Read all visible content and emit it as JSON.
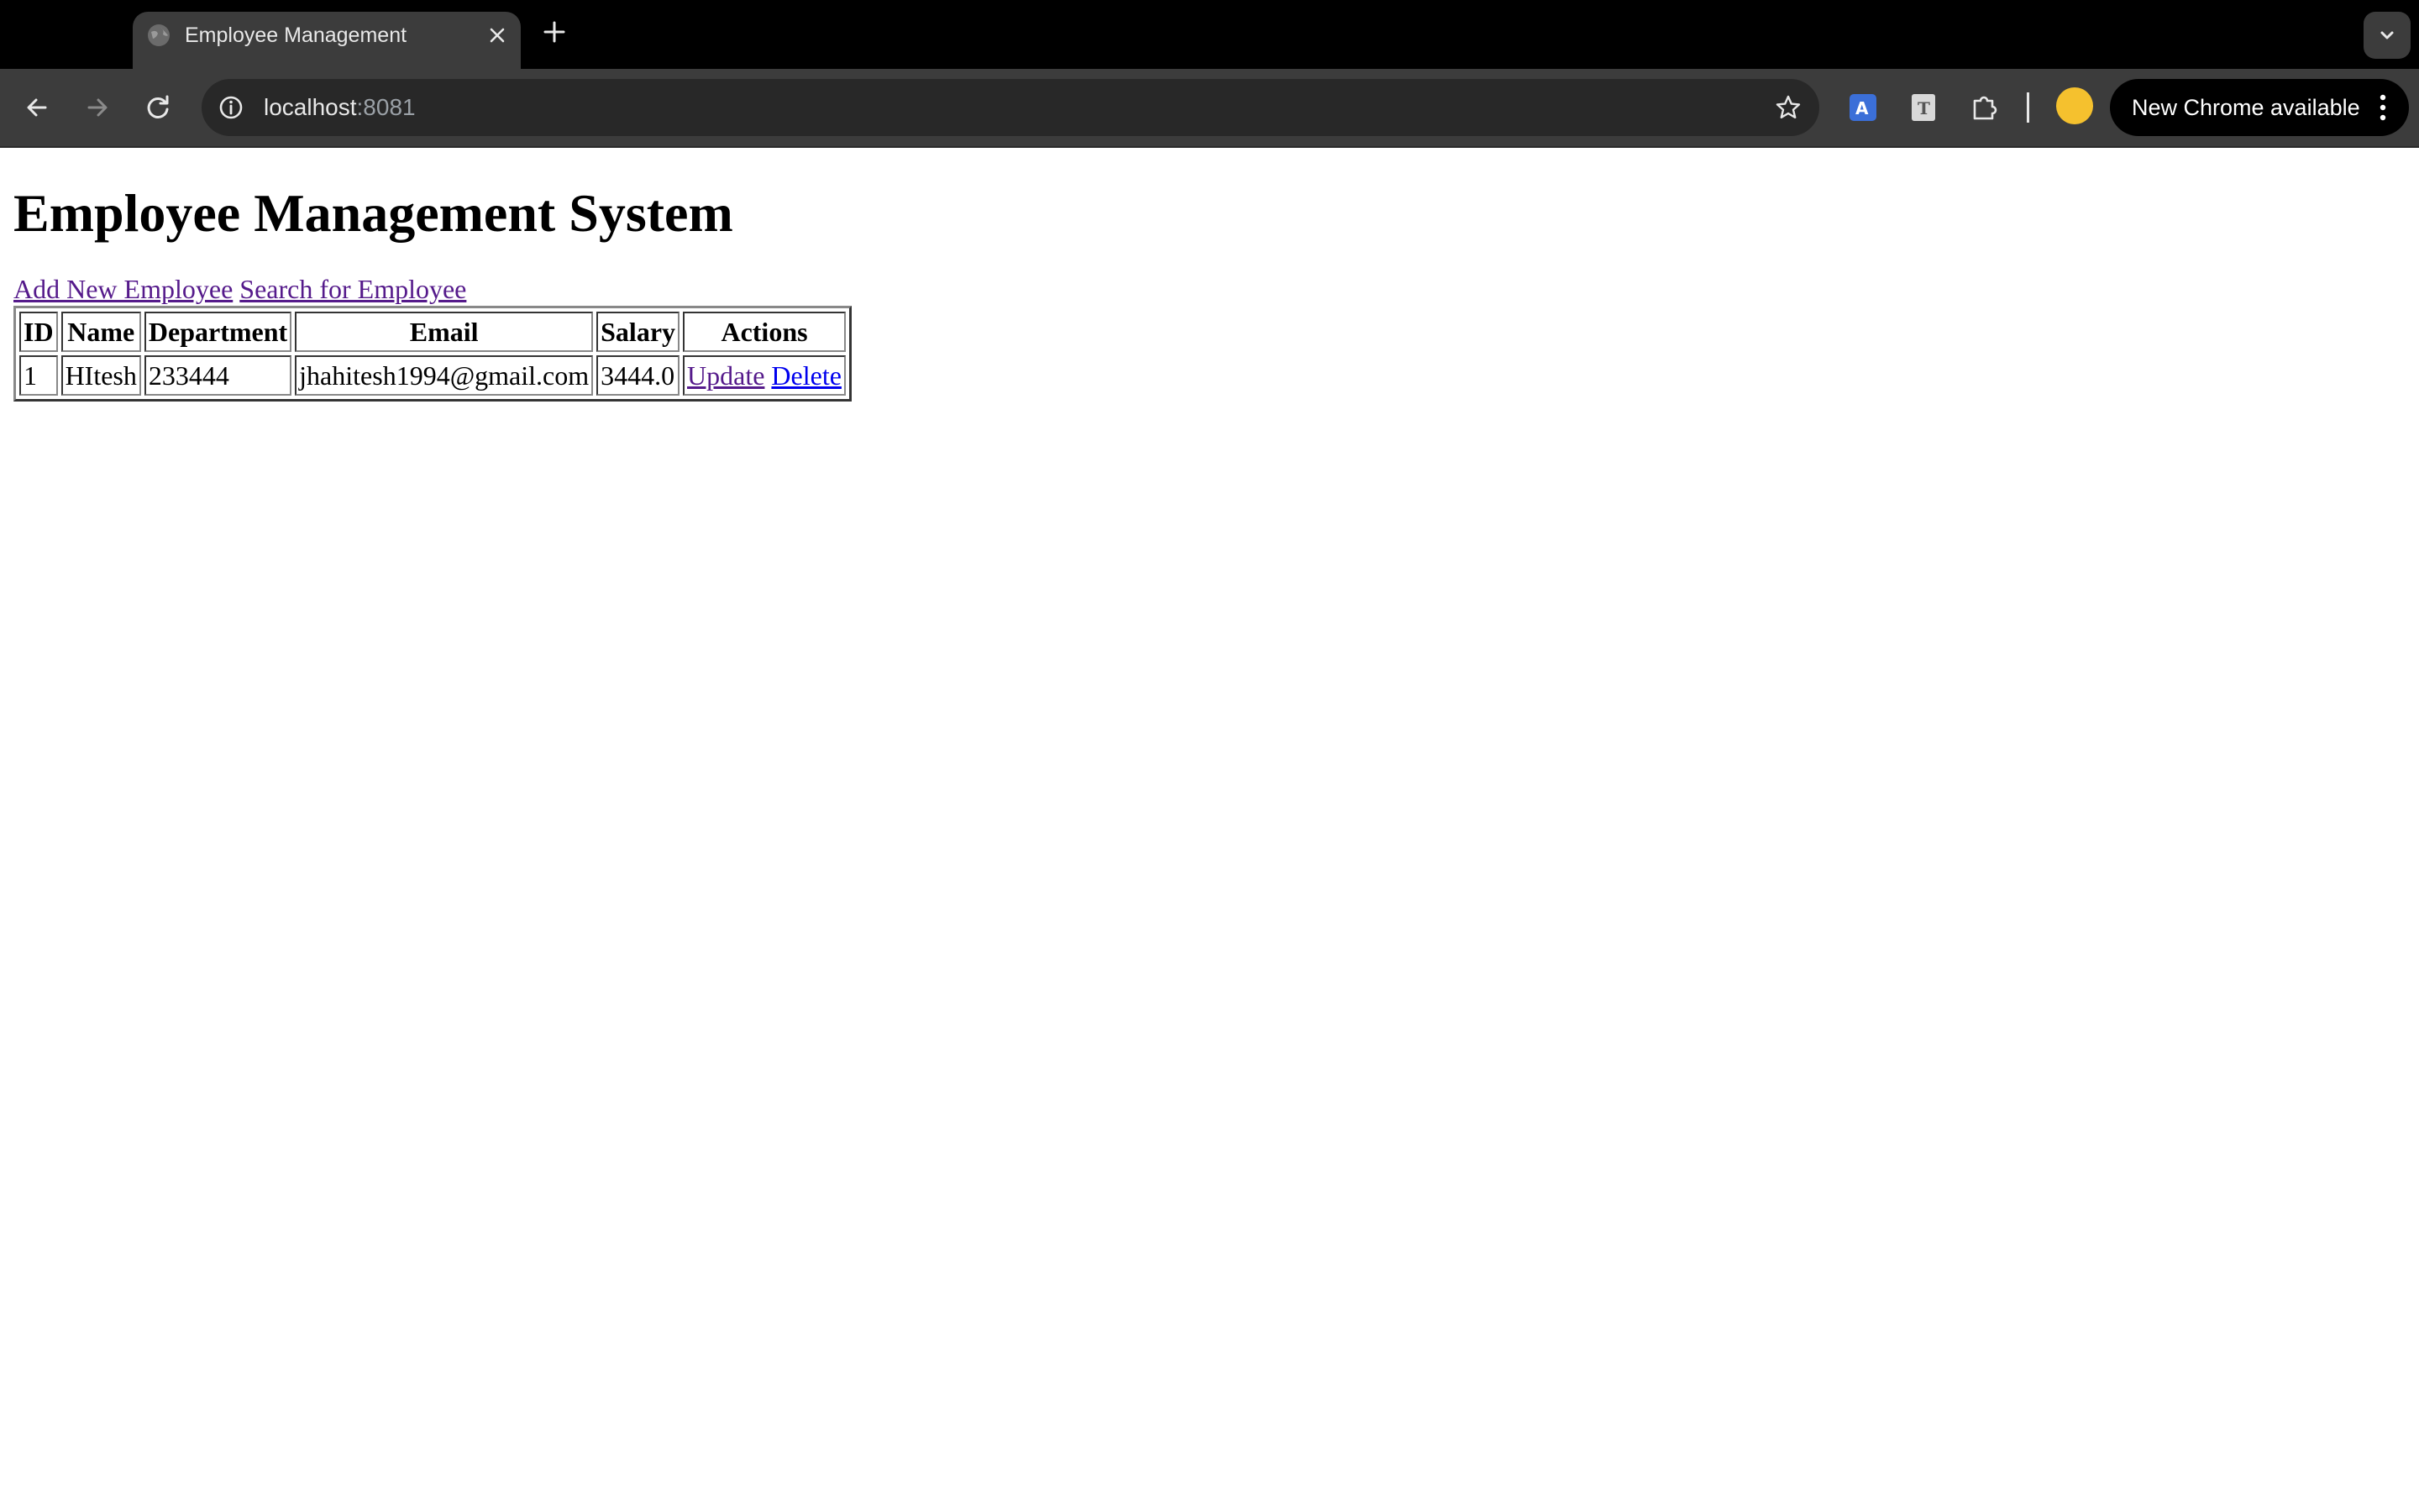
{
  "browser": {
    "tab_title": "Employee Management",
    "url_host": "localhost",
    "url_port": ":8081",
    "update_label": "New Chrome available",
    "icons": {
      "favicon": "globe-icon",
      "close": "close-icon",
      "new_tab": "plus-icon",
      "tab_search": "chevron-down-icon",
      "back": "back-arrow-icon",
      "forward": "forward-arrow-icon",
      "reload": "reload-icon",
      "site_info": "info-icon",
      "bookmark": "star-icon",
      "translate": "translate-extension-icon",
      "text": "text-extension-icon",
      "extensions": "puzzle-icon",
      "menu": "vertical-dots-icon"
    }
  },
  "page": {
    "heading": "Employee Management System",
    "links": {
      "add": "Add New Employee",
      "search": "Search for Employee"
    },
    "table": {
      "headers": [
        "ID",
        "Name",
        "Department",
        "Email",
        "Salary",
        "Actions"
      ],
      "rows": [
        {
          "id": "1",
          "name": "HItesh",
          "department": "233444",
          "email": "jhahitesh1994@gmail.com",
          "salary": "3444.0",
          "update": "Update",
          "delete": "Delete"
        }
      ]
    }
  },
  "colors": {
    "visited_link": "#551a8b",
    "link": "#0000ee",
    "chrome_dark": "#3c3c3c"
  }
}
